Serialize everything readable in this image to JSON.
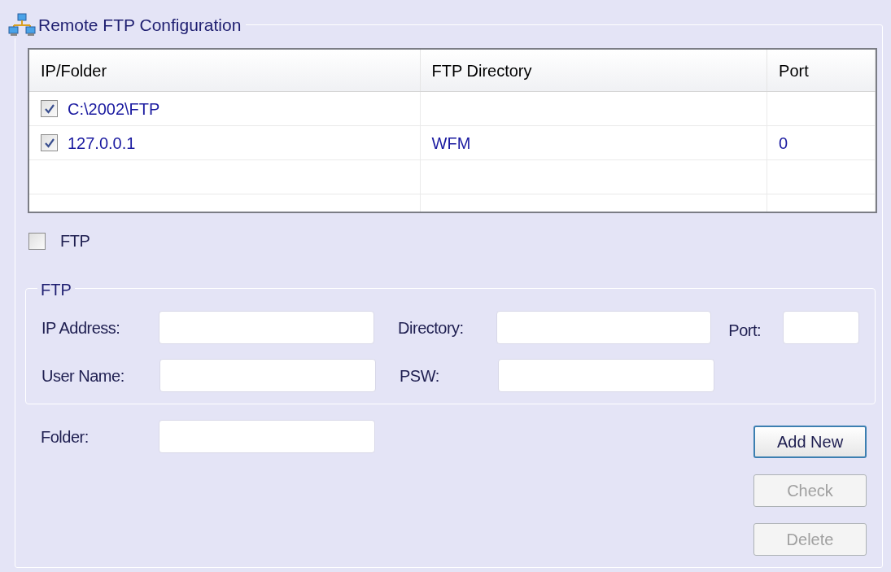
{
  "group": {
    "title": "Remote FTP Configuration"
  },
  "table": {
    "columns": [
      "IP/Folder",
      "FTP Directory",
      "Port"
    ],
    "rows": [
      {
        "checked": true,
        "cells": [
          "C:\\2002\\FTP",
          "",
          ""
        ]
      },
      {
        "checked": true,
        "cells": [
          "127.0.0.1",
          "WFM",
          "0"
        ]
      }
    ]
  },
  "ftp_checkbox": {
    "label": "FTP",
    "checked": false
  },
  "ftp_group": {
    "title": "FTP",
    "ip_label": "IP Address:",
    "directory_label": "Directory:",
    "port_label": "Port:",
    "user_label": "User Name:",
    "psw_label": "PSW:"
  },
  "folder_label": "Folder:",
  "buttons": [
    {
      "label": "Add New",
      "disabled": false
    },
    {
      "label": "Check",
      "disabled": true
    },
    {
      "label": "Delete",
      "disabled": true
    }
  ]
}
